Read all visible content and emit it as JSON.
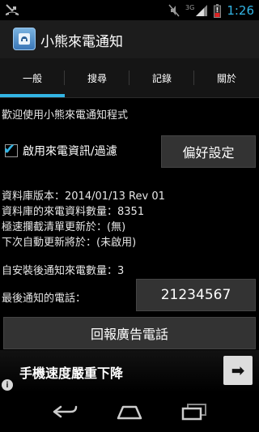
{
  "status": {
    "clock": "1:26",
    "network": "3G"
  },
  "app": {
    "title": "小熊來電通知"
  },
  "tabs": [
    {
      "label": "一般",
      "selected": true
    },
    {
      "label": "搜尋",
      "selected": false
    },
    {
      "label": "記錄",
      "selected": false
    },
    {
      "label": "關於",
      "selected": false
    }
  ],
  "general": {
    "welcome": "歡迎使用小熊來電通知程式",
    "enable_label": "啟用來電資訊/過濾",
    "enable_checked": true,
    "preferences_button": "偏好設定",
    "db_version": "資料庫版本：2014/01/13 Rev 01",
    "db_count": "資料庫的來電資料數量：8351",
    "blocklist_updated": "極速攔截清單更新於：(無)",
    "next_update": "下次自動更新將於：(未啟用)",
    "notified_count": "自安裝後通知來電數量：3",
    "last_call_label": "最後通知的電話：",
    "last_call_number": "21234567",
    "report_button": "回報廣告電話"
  },
  "ad": {
    "text": "手機速度嚴重下降",
    "info": "i"
  },
  "colors": {
    "accent": "#33b5e5",
    "background": "#000000",
    "button": "#333333"
  }
}
